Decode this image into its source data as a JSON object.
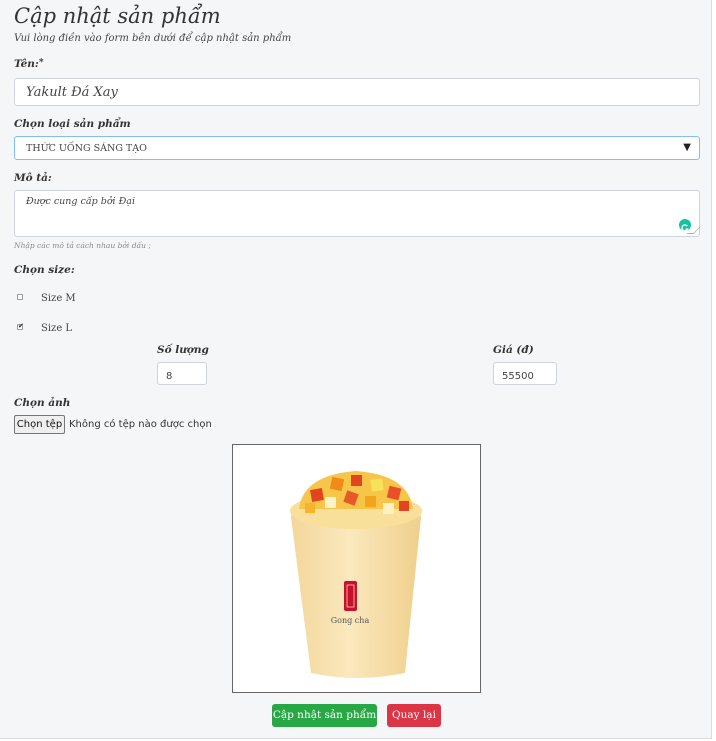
{
  "form": {
    "title": "Cập nhật sản phẩm",
    "subtitle": "Vui lòng điền vào form bên dưới để cập nhật sản phẩm",
    "name_label": "Tên:",
    "required_mark": "*",
    "name_value": "Yakult Đá Xay",
    "category_label": "Chọn loại sản phẩm",
    "category_value": "THỨC UỐNG SÁNG TẠO",
    "description_label": "Mô tả:",
    "description_value": "Được cung cấp bởi Đại",
    "description_help": "Nhập các mô tả cách nhau bởi dấu ;",
    "size_label": "Chọn size:",
    "sizes": [
      {
        "label": "Size M",
        "checked": false
      },
      {
        "label": "Size L",
        "checked": true
      }
    ],
    "quantity_label": "Số lượng",
    "quantity_value": "8",
    "price_label": "Giá (đ)",
    "price_value": "55500",
    "image_label": "Chọn ảnh",
    "file_button": "Chọn tệp",
    "file_status": "Không có tệp nào được chọn",
    "cup_logo_text": "Gong cha",
    "submit_button": "Cập nhật sản phẩm",
    "back_button": "Quay lại"
  },
  "colors": {
    "submit": "#28a745",
    "back": "#dc3545",
    "select_border": "#80bdff"
  }
}
